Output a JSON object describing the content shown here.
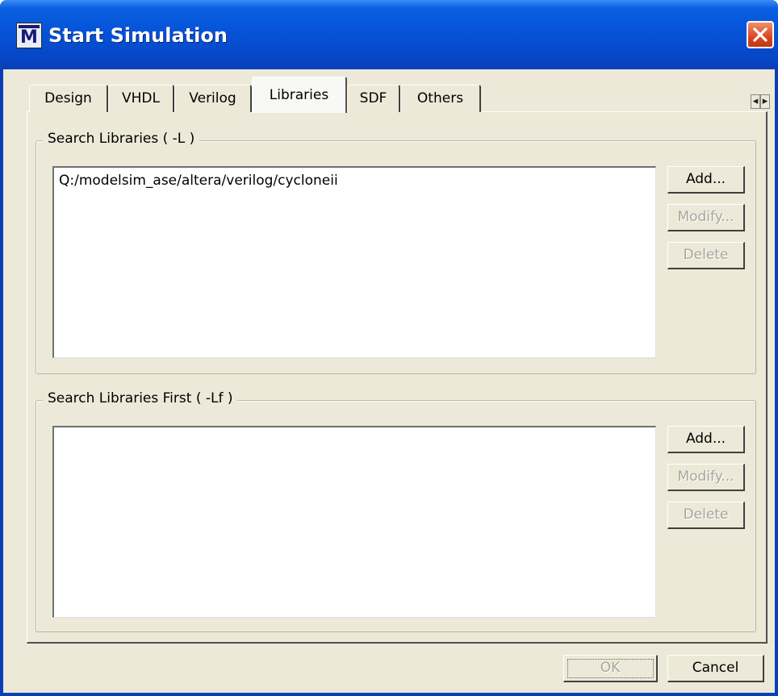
{
  "window": {
    "title": "Start Simulation",
    "icon_letter": "M"
  },
  "tabs": [
    {
      "label": "Design",
      "active": false
    },
    {
      "label": "VHDL",
      "active": false
    },
    {
      "label": "Verilog",
      "active": false
    },
    {
      "label": "Libraries",
      "active": true
    },
    {
      "label": "SDF",
      "active": false
    },
    {
      "label": "Others",
      "active": false
    }
  ],
  "tab_scroll": {
    "left": "◂",
    "right": "▸"
  },
  "search_libraries": {
    "legend": "Search Libraries ( -L )",
    "items": [
      "Q:/modelsim_ase/altera/verilog/cycloneii"
    ],
    "add_label": "Add...",
    "modify_label": "Modify...",
    "delete_label": "Delete"
  },
  "search_libraries_first": {
    "legend": "Search Libraries First ( -Lf )",
    "items": [],
    "add_label": "Add...",
    "modify_label": "Modify...",
    "delete_label": "Delete"
  },
  "footer": {
    "ok_label": "OK",
    "cancel_label": "Cancel"
  },
  "colors": {
    "titlebar": "#0653d8",
    "dialog_bg": "#ece9d8",
    "close_button": "#d84820"
  }
}
